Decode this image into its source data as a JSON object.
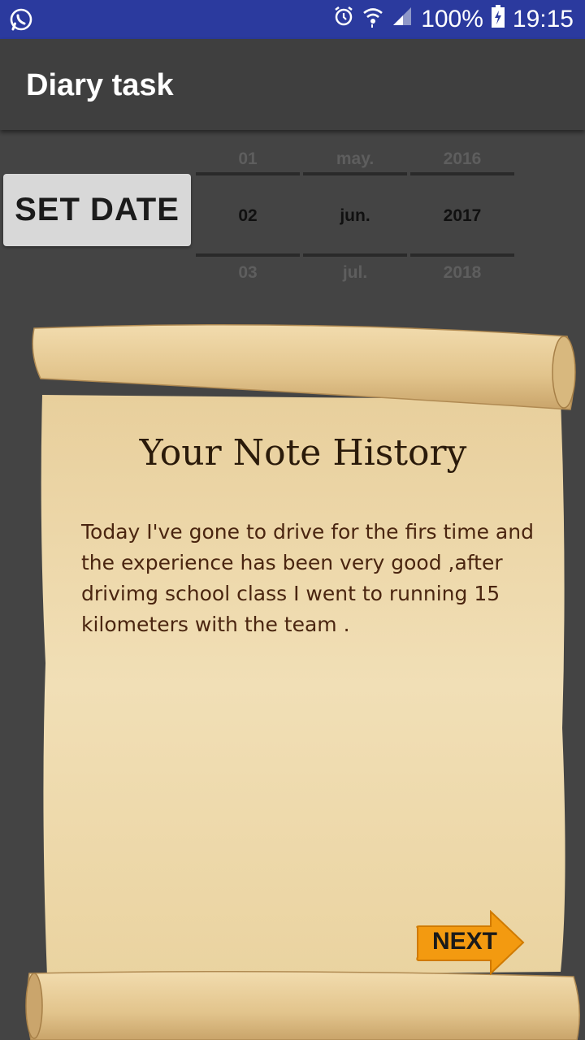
{
  "status_bar": {
    "battery": "100%",
    "time": "19:15",
    "icons": [
      "whatsapp-icon",
      "alarm-icon",
      "wifi-icon",
      "signal-icon",
      "battery-icon"
    ]
  },
  "app_bar": {
    "title": "Diary task"
  },
  "set_date_button": {
    "label": "SET DATE"
  },
  "date_picker": {
    "day": {
      "prev": "01",
      "current": "02",
      "next": "03"
    },
    "month": {
      "prev": "may.",
      "current": "jun.",
      "next": "jul."
    },
    "year": {
      "prev": "2016",
      "current": "2017",
      "next": "2018"
    }
  },
  "note": {
    "title": "Your Note History",
    "text": "Today I've gone to drive for the firs time and the experience has been very good ,after drivimg school class I went to running 15 kilometers with the team ."
  },
  "next_button": {
    "label": "NEXT"
  },
  "colors": {
    "status_bar": "#2b3a9e",
    "app_bar": "#3f3f3f",
    "background": "#444444",
    "parchment": "#efd9ac",
    "next_arrow": "#f39a10"
  }
}
